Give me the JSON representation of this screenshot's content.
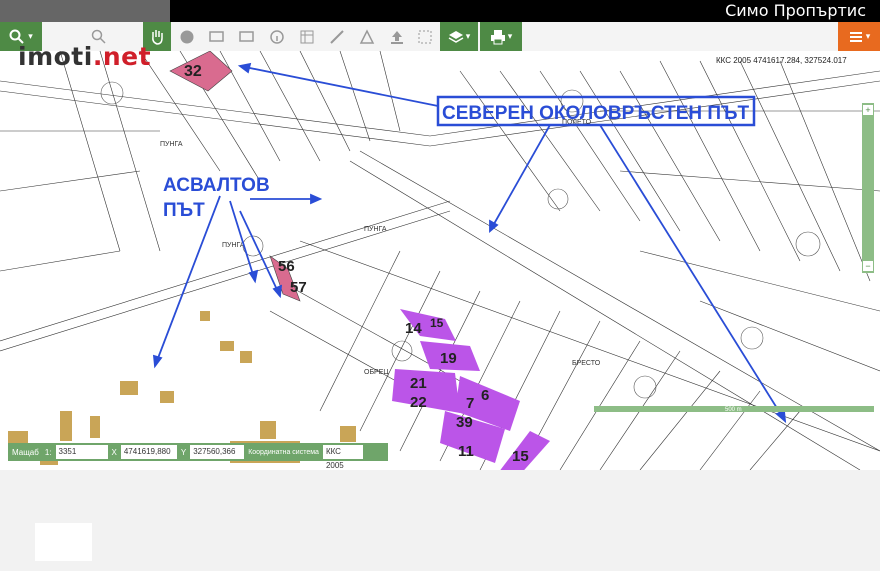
{
  "topbar": {
    "brand": "Симо Пропъртис"
  },
  "logo": {
    "text": "imoti",
    "suffix": ".net"
  },
  "toolbar": {
    "search_icon": "search-icon",
    "zoom_in_icon": "zoom-in-icon",
    "pan_icon": "hand-icon",
    "globe_icon": "globe-icon",
    "layers_icon": "layers-icon",
    "print_icon": "print-icon",
    "menu_icon": "menu-icon"
  },
  "map": {
    "crs_header": "ККС 2005 4741617.284, 327524.017",
    "annotations": {
      "ring_road": "СЕВЕРЕН ОКОЛОВРЪСТЕН ПЪТ",
      "asphalt_road_1": "АСВАЛТОВ",
      "asphalt_road_2": "ПЪТ"
    },
    "highlighted_plots": [
      "32",
      "56",
      "57",
      "14",
      "15",
      "19",
      "21",
      "22",
      "7",
      "6",
      "39",
      "11",
      "15"
    ],
    "place_labels": [
      "ПУНГА",
      "ПУНГА",
      "ПУНГА",
      "ОБРЕЦ",
      "БРЕСТО",
      "ПОЛЕТО"
    ],
    "scale_bar": "500 m"
  },
  "coords_bar": {
    "scale_label": "Мащаб",
    "scale_prefix": "1:",
    "scale_value": "3351",
    "x_label": "X",
    "x_value": "4741619,880",
    "y_label": "Y",
    "y_value": "327560,366",
    "crs_label": "Координатна система",
    "crs_value": "ККС 2005"
  },
  "colors": {
    "plot_purple": "#bb55e8",
    "plot_pink": "#d96b8f",
    "arrow_blue": "#2a4dd6",
    "toolbar_green": "#4e8a45",
    "toolbar_orange": "#e86a1f"
  }
}
